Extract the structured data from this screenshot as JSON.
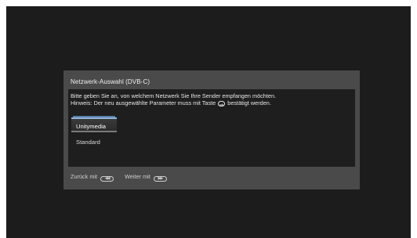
{
  "dialog": {
    "title": "Netzwerk-Auswahl (DVB-C)",
    "message_line1": "Bitte geben Sie an, von welchem Netzwerk Sie Ihre Sender empfangen möchten.",
    "message_line2_before": "Hinweis: Der neu ausgewählte Parameter muss mit Taste",
    "ok_icon_label": "ok",
    "message_line2_after": "bestätigt werden.",
    "options": [
      {
        "label": "Unitymedia",
        "selected": true
      },
      {
        "label": "Standard",
        "selected": false
      }
    ]
  },
  "footer": {
    "back_label": "Zurück mit",
    "back_icon_glyph": "◀◀",
    "next_label": "Weiter mit",
    "next_icon_glyph": "▶▶"
  },
  "icons": {
    "ok": "ok-button-icon",
    "back": "rewind-button-icon",
    "next": "fast-forward-button-icon"
  },
  "colors": {
    "screen_background": "#1c1c1c",
    "dialog_background": "#4a4a4a",
    "body_background": "#1e1e1e",
    "selection_highlight": "#8fb3d9"
  }
}
